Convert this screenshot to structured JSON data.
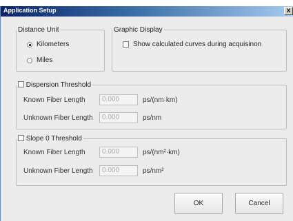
{
  "window": {
    "title": "Application Setup",
    "close_label": "x"
  },
  "distance_unit": {
    "legend": "Distance Unit",
    "options": [
      {
        "label": "Kilometers",
        "selected": true
      },
      {
        "label": "Miles",
        "selected": false
      }
    ]
  },
  "graphic_display": {
    "legend": "Graphic Display",
    "show_curves_label": "Show calculated curves during acquisinon",
    "show_curves_checked": false
  },
  "dispersion_threshold": {
    "legend": "Dispersion Threshold",
    "checked": false,
    "known_label": "Known Fiber Length",
    "known_value": "0.000",
    "known_unit": "ps/(nm·km)",
    "unknown_label": "Unknown Fiber Length",
    "unknown_value": "0.000",
    "unknown_unit": "ps/nm"
  },
  "slope_threshold": {
    "legend": "Slope 0 Threshold",
    "checked": false,
    "known_label": "Known Fiber Length",
    "known_value": "0.000",
    "known_unit": "ps/(nm²·km)",
    "unknown_label": "Unknown Fiber Length",
    "unknown_value": "0.000",
    "unknown_unit": "ps/nm²"
  },
  "buttons": {
    "ok_label": "OK",
    "cancel_label": "Cancel"
  }
}
